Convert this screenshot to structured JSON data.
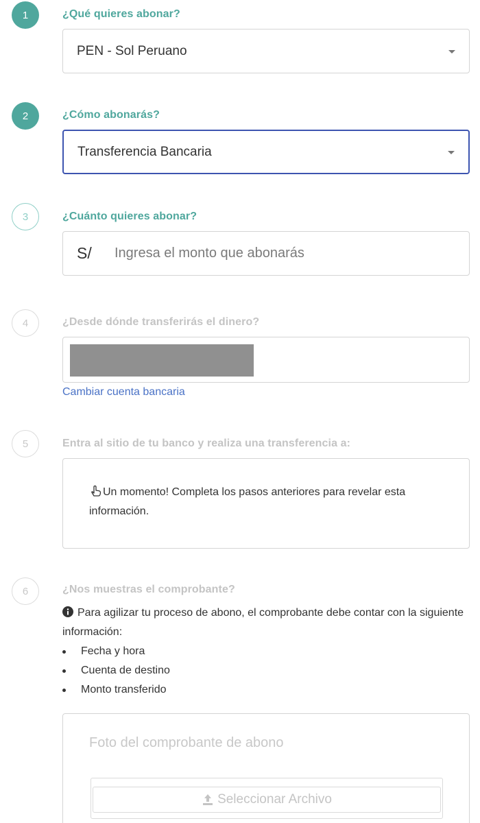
{
  "steps": [
    {
      "number": "1",
      "label": "¿Qué quieres abonar?"
    },
    {
      "number": "2",
      "label": "¿Cómo abonarás?"
    },
    {
      "number": "3",
      "label": "¿Cuánto quieres abonar?"
    },
    {
      "number": "4",
      "label": "¿Desde dónde transferirás el dinero?"
    },
    {
      "number": "5",
      "label": "Entra al sitio de tu banco y realiza una transferencia a:"
    },
    {
      "number": "6",
      "label": "¿Nos muestras el comprobante?"
    }
  ],
  "currency_select": {
    "value": "PEN - Sol Peruano"
  },
  "method_select": {
    "value": "Transferencia Bancaria"
  },
  "amount": {
    "currency_symbol": "S/",
    "placeholder": "Ingresa el monto que abonarás",
    "value": ""
  },
  "bank_account": {
    "change_link": "Cambiar cuenta bancaria"
  },
  "transfer_info": {
    "message": "Un momento! Completa los pasos anteriores para revelar esta información."
  },
  "receipt": {
    "notice": "Para agilizar tu proceso de abono, el comprobante debe contar con la siguiente información:",
    "requirements": [
      "Fecha y hora",
      "Cuenta de destino",
      "Monto transferido"
    ],
    "upload_label": "Foto del comprobante de abono",
    "upload_button": "Seleccionar Archivo"
  },
  "colors": {
    "accent_teal": "#4fa79d",
    "focus_blue": "#3d54b0",
    "link_blue": "#4a72c6",
    "disabled_gray": "#c4c4c4"
  },
  "icons": {
    "caret": "chevron-down-icon",
    "hand": "hand-pointer-icon",
    "info": "info-circle-icon",
    "upload": "upload-icon"
  }
}
